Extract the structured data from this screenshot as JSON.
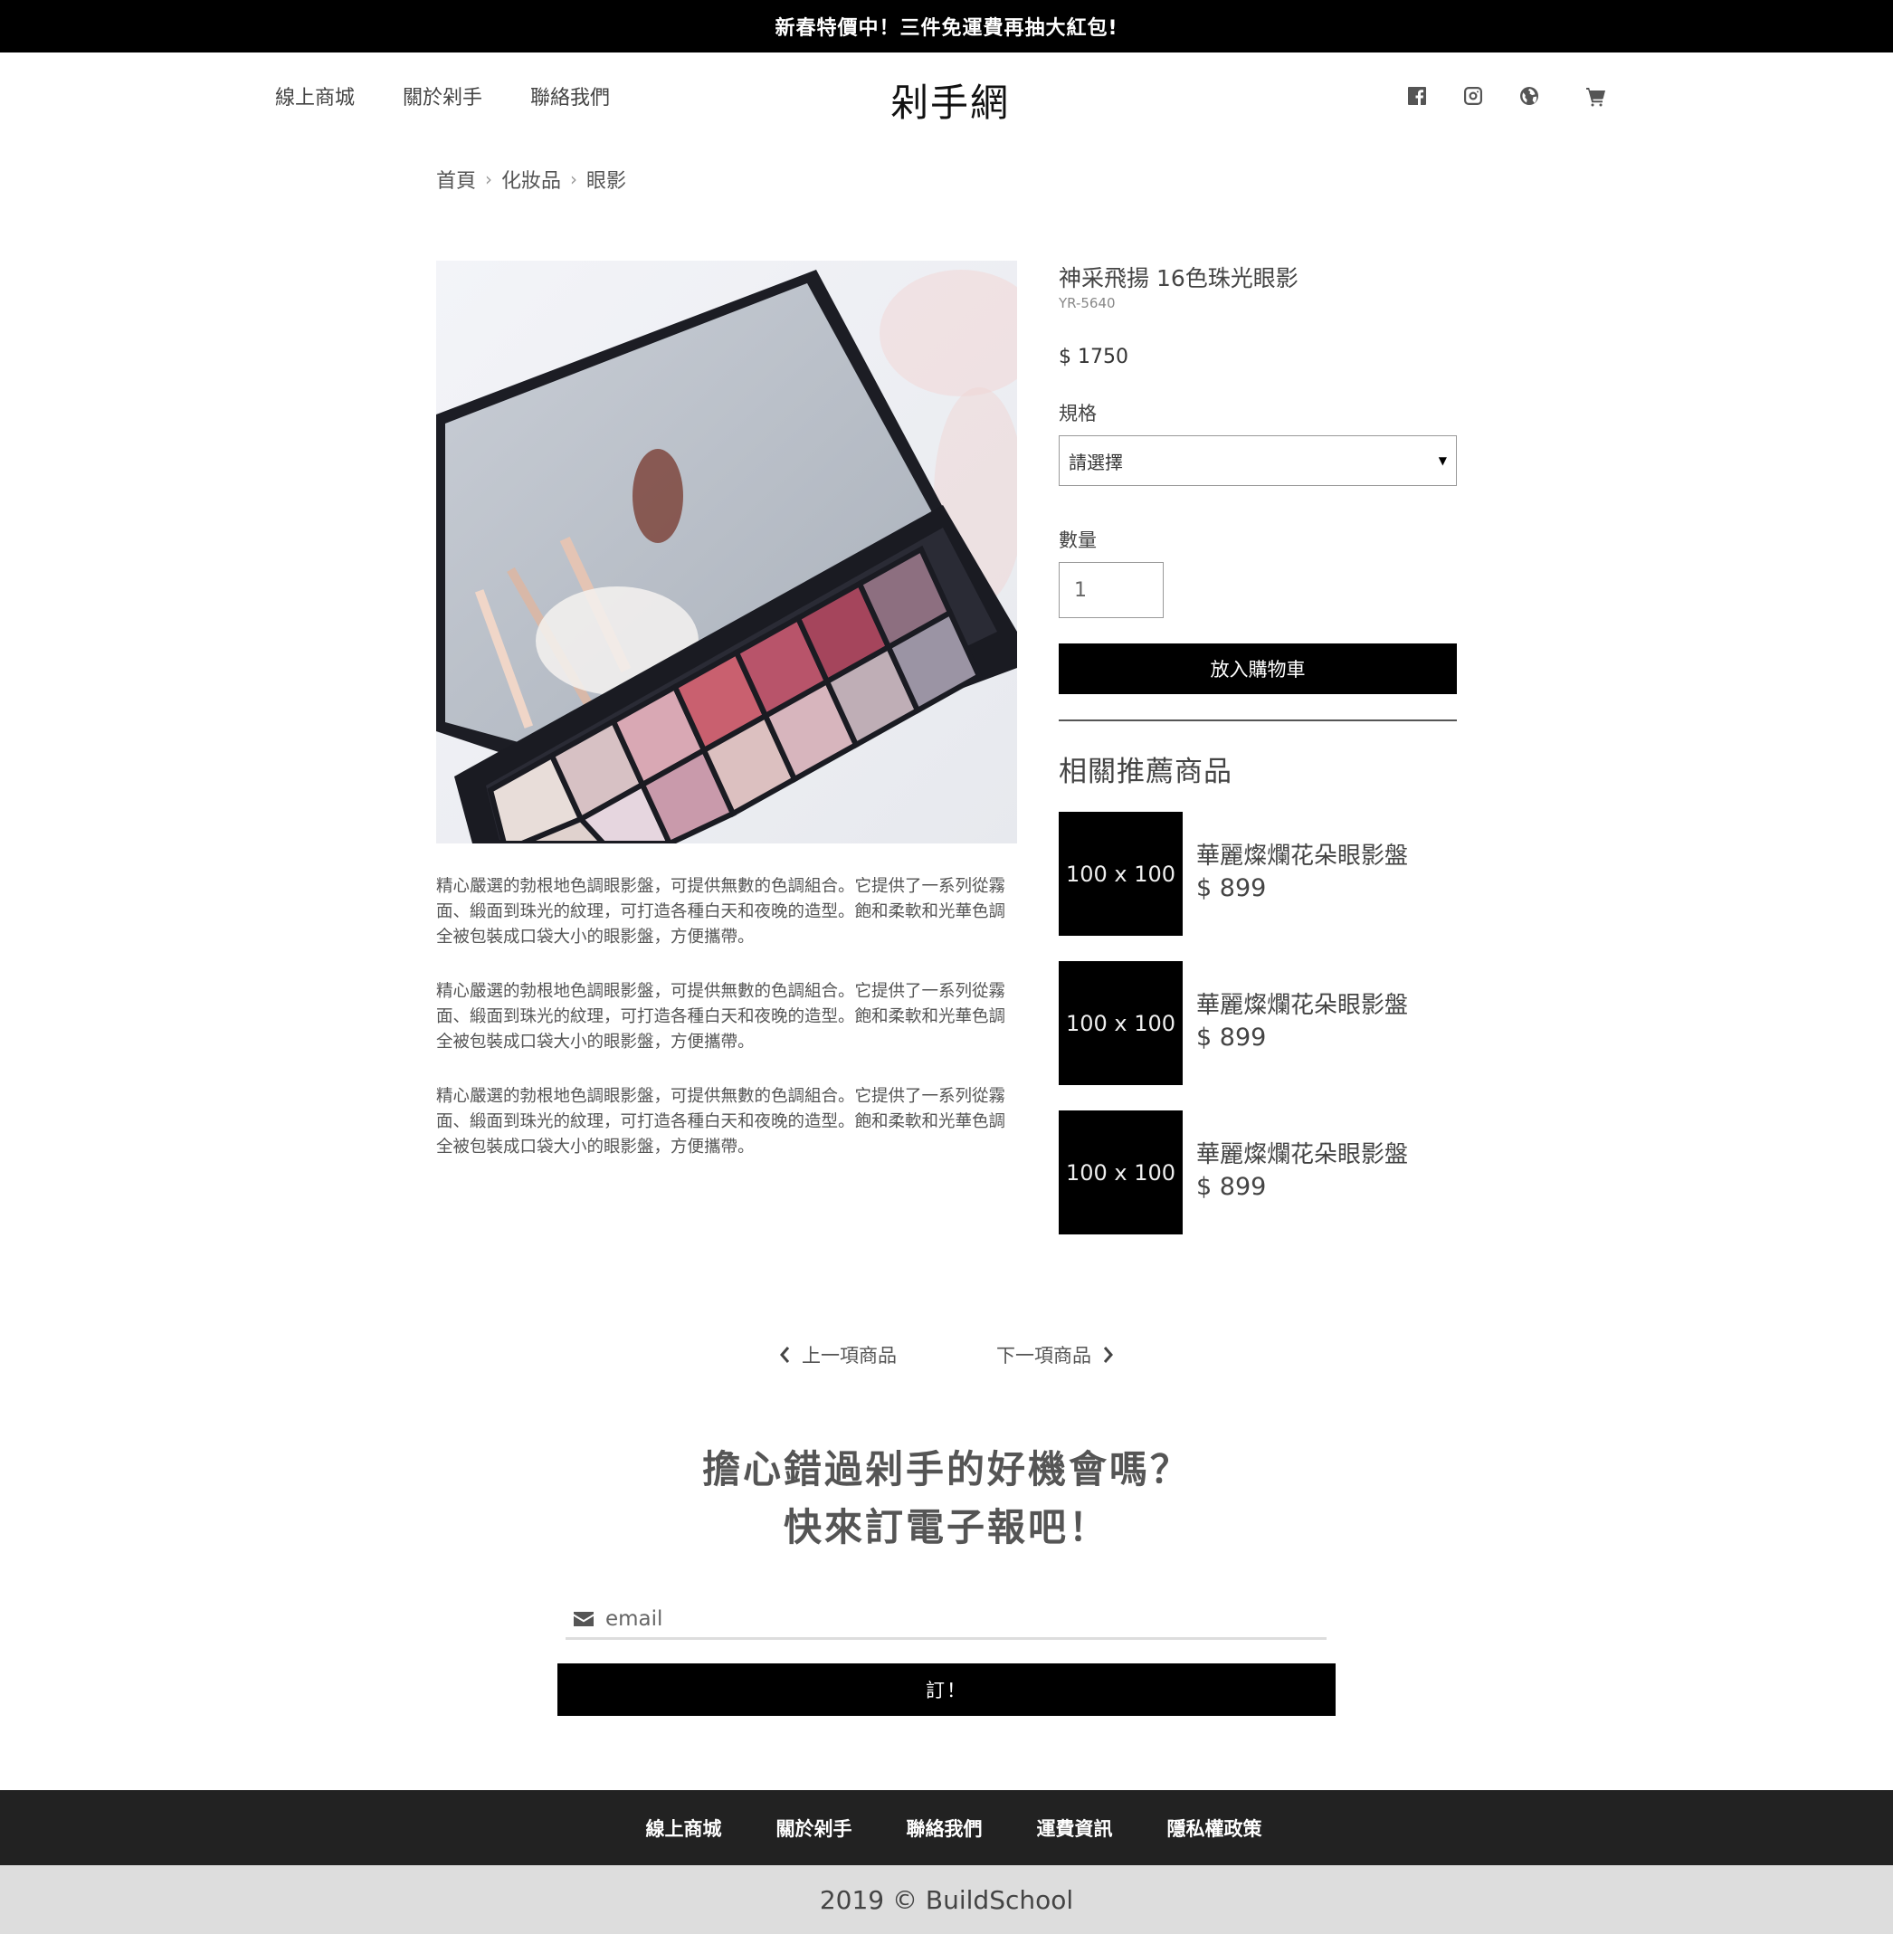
{
  "announcement": "新春特價中！三件免運費再抽大紅包!",
  "header": {
    "nav": [
      "線上商城",
      "關於剁手",
      "聯絡我們"
    ],
    "brand": "剁手網",
    "icons": [
      "facebook-icon",
      "instagram-icon",
      "globe-icon",
      "cart-icon"
    ]
  },
  "breadcrumb": [
    "首頁",
    "化妝品",
    "眼影"
  ],
  "breadcrumb_sep": "›",
  "product": {
    "name": "神采飛揚 16色珠光眼影",
    "sku": "YR-5640",
    "price": "$ 1750",
    "spec_label": "規格",
    "spec_value": "請選擇",
    "qty_label": "數量",
    "qty_value": "1",
    "add_to_cart": "放入購物車",
    "description": [
      "精心嚴選的勃根地色調眼影盤，可提供無數的色調組合。它提供了一系列從霧面、緞面到珠光的紋理，可打造各種白天和夜晚的造型。飽和柔軟和光華色調全被包裝成口袋大小的眼影盤，方便攜帶。",
      "精心嚴選的勃根地色調眼影盤，可提供無數的色調組合。它提供了一系列從霧面、緞面到珠光的紋理，可打造各種白天和夜晚的造型。飽和柔軟和光華色調全被包裝成口袋大小的眼影盤，方便攜帶。",
      "精心嚴選的勃根地色調眼影盤，可提供無數的色調組合。它提供了一系列從霧面、緞面到珠光的紋理，可打造各種白天和夜晚的造型。飽和柔軟和光華色調全被包裝成口袋大小的眼影盤，方便攜帶。"
    ]
  },
  "related": {
    "title": "相關推薦商品",
    "items": [
      {
        "thumb": "100 x 100",
        "name": "華麗燦爛花朵眼影盤",
        "price": "$ 899"
      },
      {
        "thumb": "100 x 100",
        "name": "華麗燦爛花朵眼影盤",
        "price": "$ 899"
      },
      {
        "thumb": "100 x 100",
        "name": "華麗燦爛花朵眼影盤",
        "price": "$ 899"
      }
    ]
  },
  "pager": {
    "prev": "上一項商品",
    "next": "下一項商品"
  },
  "newsletter": {
    "line1": "擔心錯過剁手的好機會嗎？",
    "line2": "快來訂電子報吧！",
    "placeholder": "email",
    "button": "訂！"
  },
  "footer": {
    "nav": [
      "線上商城",
      "關於剁手",
      "聯絡我們",
      "運費資訊",
      "隱私權政策"
    ],
    "copyright": "2019 © BuildSchool"
  }
}
